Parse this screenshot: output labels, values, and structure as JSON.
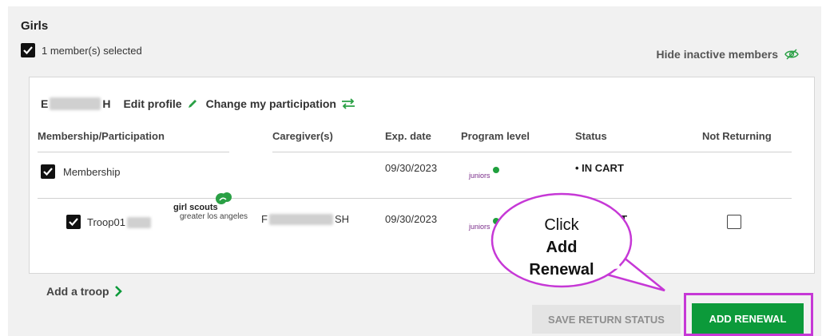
{
  "section": {
    "title": "Girls",
    "selected_count": "1 member(s) selected",
    "hide_inactive": "Hide inactive members"
  },
  "member": {
    "name_start": "E",
    "name_end": "H",
    "edit_profile": "Edit profile",
    "change_participation": "Change my participation"
  },
  "table": {
    "headers": [
      "Membership/Participation",
      "Caregiver(s)",
      "Exp. date",
      "Program level",
      "Status",
      "Not Returning"
    ],
    "rows": [
      {
        "name": "Membership",
        "caregiver": "",
        "exp_date": "09/30/2023",
        "program_level": "juniors",
        "status": "• IN CART",
        "checked": true
      },
      {
        "name": "Troop01",
        "caregiver_start": "F",
        "caregiver_end": "SH",
        "exp_date": "09/30/2023",
        "program_level": "juniors",
        "status": "CART",
        "checked": true,
        "not_returning": false
      }
    ]
  },
  "council_logo": {
    "line1": "girl scouts",
    "line2": "greater los angeles"
  },
  "actions": {
    "add_troop": "Add a troop",
    "save_return_status": "SAVE RETURN STATUS",
    "add_renewal": "ADD RENEWAL"
  },
  "callout": {
    "line1": "Click",
    "line2": "Add",
    "line3": "Renewal"
  },
  "colors": {
    "green": "#0c9a3a",
    "highlight": "#c638d6",
    "juniors": "#7a2d8a"
  }
}
